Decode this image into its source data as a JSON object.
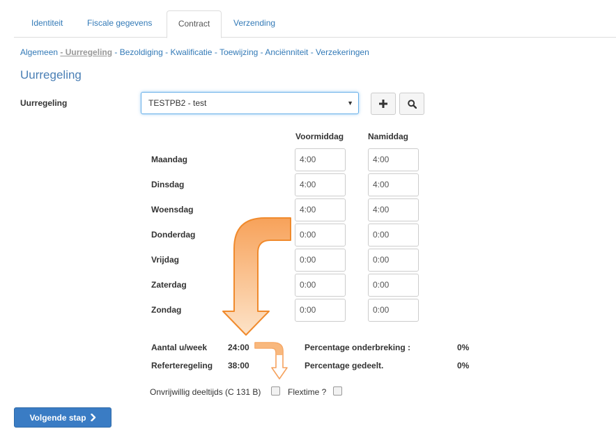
{
  "tabs": [
    {
      "label": "Identiteit"
    },
    {
      "label": "Fiscale gegevens"
    },
    {
      "label": "Contract"
    },
    {
      "label": "Verzending"
    }
  ],
  "subnav": {
    "items": [
      "Algemeen",
      "- Uurregeling",
      "- Bezoldiging",
      "- Kwalificatie",
      "- Toewijzing",
      "- Anciënniteit",
      "- Verzekeringen"
    ],
    "active": "- Uurregeling"
  },
  "section_title": "Uurregeling",
  "uurregeling": {
    "label": "Uurregeling",
    "selected": "TESTPB2 - test"
  },
  "schedule": {
    "col_am": "Voormiddag",
    "col_pm": "Namiddag",
    "days": [
      {
        "name": "Maandag",
        "am": "4:00",
        "pm": "4:00"
      },
      {
        "name": "Dinsdag",
        "am": "4:00",
        "pm": "4:00"
      },
      {
        "name": "Woensdag",
        "am": "4:00",
        "pm": "4:00"
      },
      {
        "name": "Donderdag",
        "am": "0:00",
        "pm": "0:00"
      },
      {
        "name": "Vrijdag",
        "am": "0:00",
        "pm": "0:00"
      },
      {
        "name": "Zaterdag",
        "am": "0:00",
        "pm": "0:00"
      },
      {
        "name": "Zondag",
        "am": "0:00",
        "pm": "0:00"
      }
    ]
  },
  "summary": {
    "hours_week_label": "Aantal u/week",
    "hours_week_value": "24:00",
    "reference_label": "Referteregeling",
    "reference_value": "38:00",
    "interruption_label": "Percentage onderbreking :",
    "interruption_value": "0%",
    "shared_label": "Percentage gedeelt.",
    "shared_value": "0%"
  },
  "options": {
    "involuntary_label": "Onvrijwillig deeltijds (C 131 B)",
    "flextime_label": "Flextime ?"
  },
  "next_button": "Volgende stap",
  "colors": {
    "accent": "#337ab7",
    "button": "#3a7cc4",
    "arrow": "#f5923e"
  }
}
